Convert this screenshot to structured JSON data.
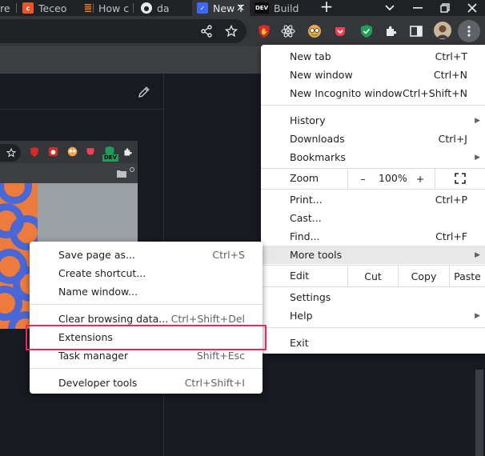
{
  "tabs": [
    {
      "title": "re",
      "favicon": "none"
    },
    {
      "title": "Teceo",
      "favicon": "c-logo"
    },
    {
      "title": "How c",
      "favicon": "stackoverflow"
    },
    {
      "title": "da",
      "favicon": "github"
    },
    {
      "title": "New T",
      "favicon": "app-logo",
      "close": "✕"
    },
    {
      "title": "Build",
      "favicon": "dev",
      "favicon_text": "DEV"
    }
  ],
  "new_tab_symbol": "+",
  "toolbar": {
    "icons": [
      "share-icon",
      "star-icon",
      "ublock-icon",
      "react-devtools-icon",
      "avatar-extension-icon",
      "pocket-icon",
      "shield-check-icon",
      "puzzle-icon",
      "sidebar-icon",
      "profile-avatar",
      "kebab-menu-icon"
    ]
  },
  "embedded_screenshot": {
    "dev_badge": "DEV"
  },
  "main_menu": {
    "group1": [
      {
        "label": "New tab",
        "shortcut": "Ctrl+T"
      },
      {
        "label": "New window",
        "shortcut": "Ctrl+N"
      },
      {
        "label": "New Incognito window",
        "shortcut": "Ctrl+Shift+N"
      }
    ],
    "group2": [
      {
        "label": "History",
        "shortcut": "",
        "submenu": true
      },
      {
        "label": "Downloads",
        "shortcut": "Ctrl+J"
      },
      {
        "label": "Bookmarks",
        "shortcut": "",
        "submenu": true
      }
    ],
    "zoom": {
      "label": "Zoom",
      "minus": "–",
      "value": "100%",
      "plus": "+"
    },
    "group3": [
      {
        "label": "Print...",
        "shortcut": "Ctrl+P"
      },
      {
        "label": "Cast...",
        "shortcut": ""
      },
      {
        "label": "Find...",
        "shortcut": "Ctrl+F"
      },
      {
        "label": "More tools",
        "shortcut": "",
        "submenu": true,
        "highlighted": true
      }
    ],
    "edit": {
      "label": "Edit",
      "cut": "Cut",
      "copy": "Copy",
      "paste": "Paste"
    },
    "group4": [
      {
        "label": "Settings",
        "shortcut": ""
      },
      {
        "label": "Help",
        "shortcut": "",
        "submenu": true
      }
    ],
    "exit": {
      "label": "Exit"
    }
  },
  "sub_menu": {
    "group1": [
      {
        "label": "Save page as...",
        "shortcut": "Ctrl+S"
      },
      {
        "label": "Create shortcut...",
        "shortcut": ""
      },
      {
        "label": "Name window...",
        "shortcut": ""
      }
    ],
    "group2": [
      {
        "label": "Clear browsing data...",
        "shortcut": "Ctrl+Shift+Del"
      },
      {
        "label": "Extensions",
        "shortcut": "",
        "highlighted_box": true
      },
      {
        "label": "Task manager",
        "shortcut": "Shift+Esc"
      }
    ],
    "group3": [
      {
        "label": "Developer tools",
        "shortcut": "Ctrl+Shift+I"
      }
    ]
  },
  "colors": {
    "highlight_box": "#e5295a",
    "tab_active": "#35363a",
    "menu_bg": "#ffffff",
    "page_bg": "#171a21"
  }
}
